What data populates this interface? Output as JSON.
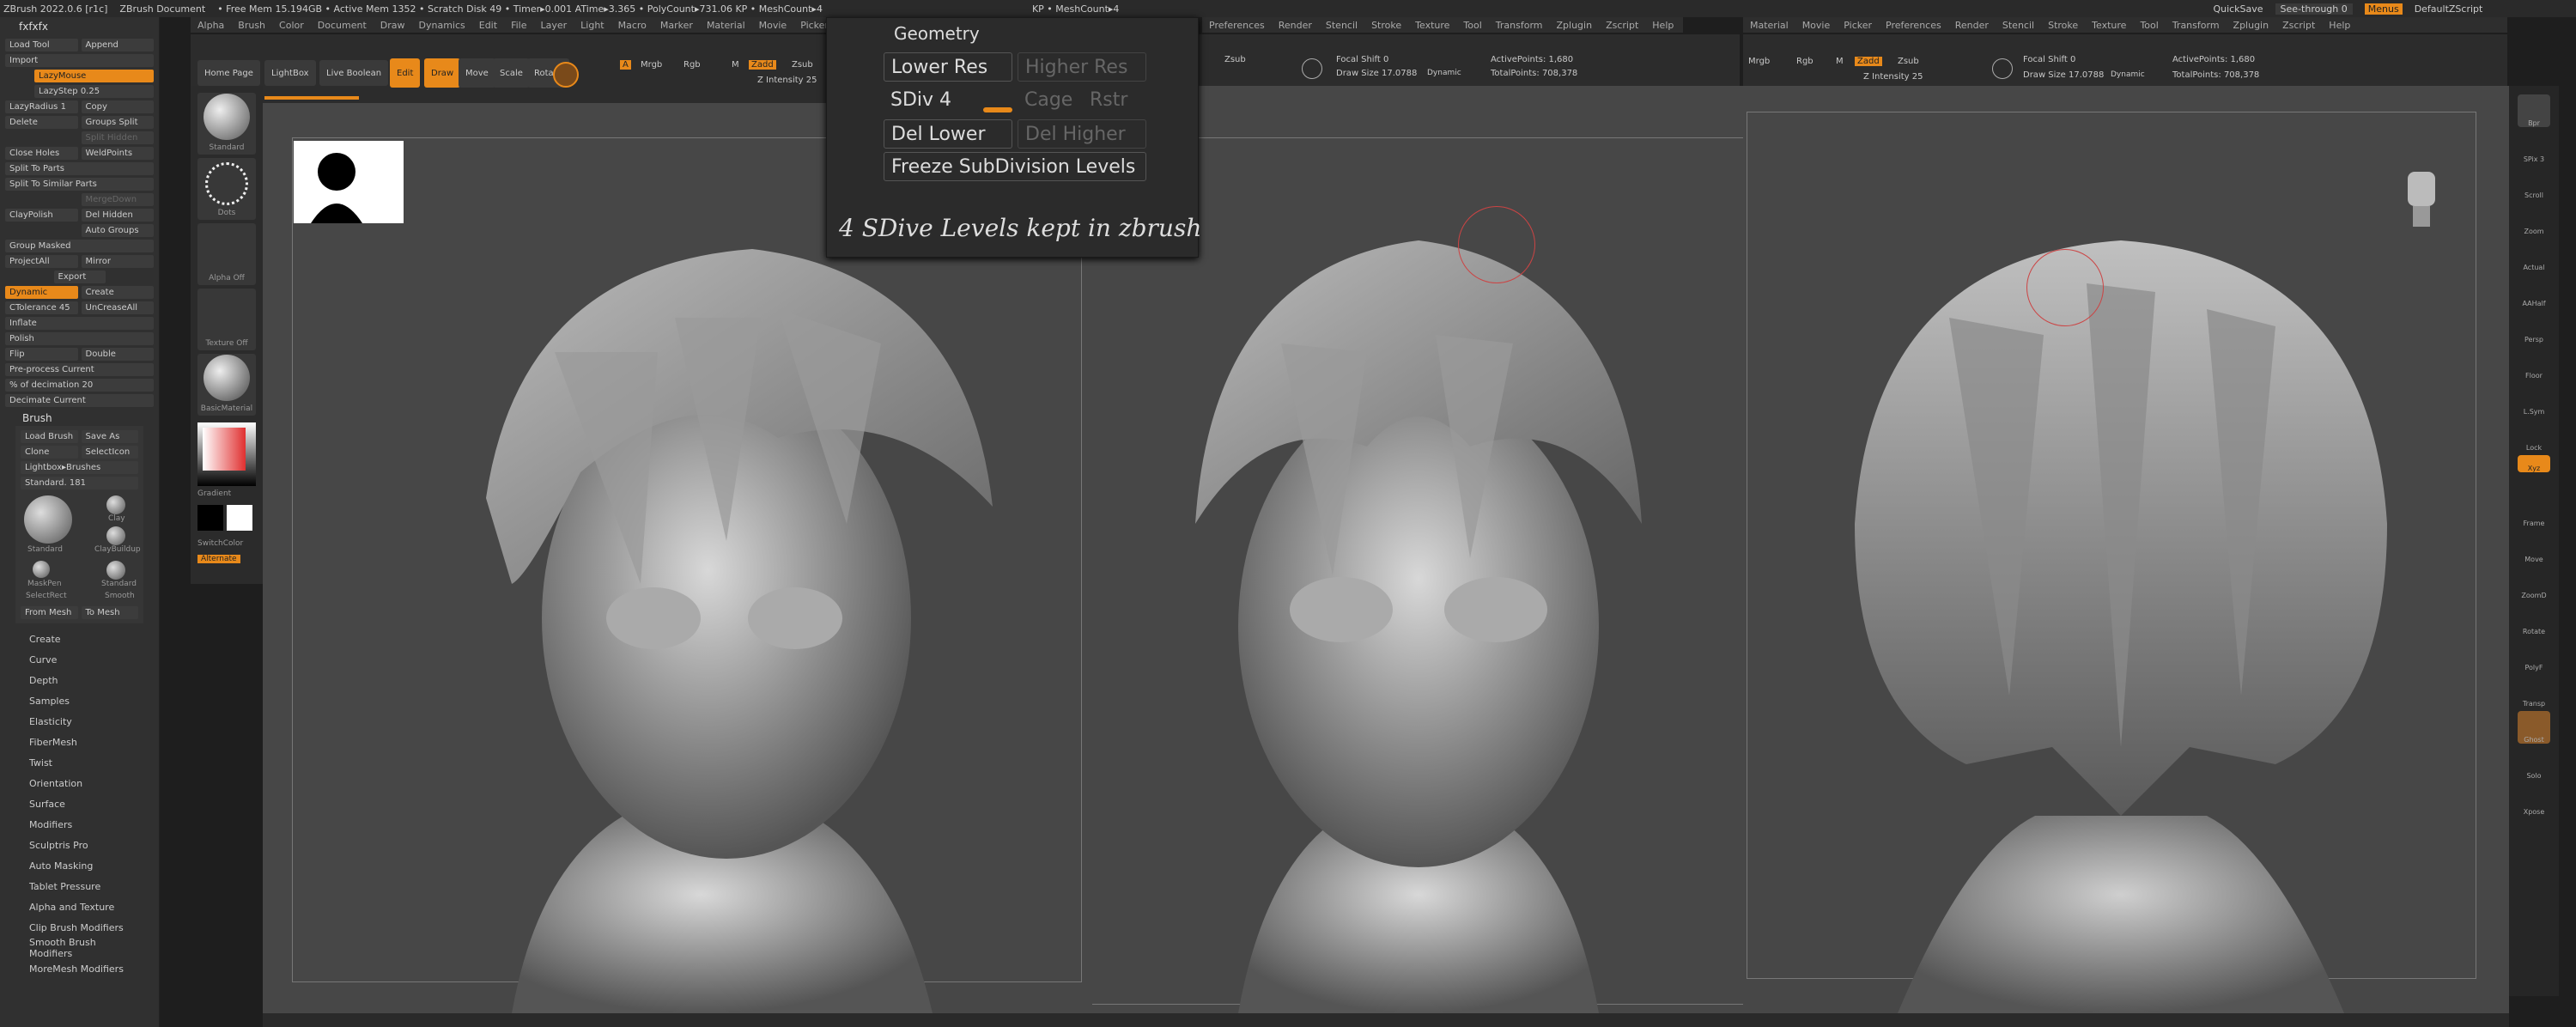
{
  "titlebar": {
    "app": "ZBrush 2022.0.6 [r1c]",
    "doc": "ZBrush Document",
    "stats": "• Free Mem 15.194GB • Active Mem 1352 • Scratch Disk 49 • Timer▸0.001 ATime▸3.365 • PolyCount▸731.06 KP • MeshCount▸4",
    "center": "KP • MeshCount▸4",
    "quicksave": "QuickSave",
    "seethrough": "See-through 0",
    "menus": "Menus",
    "script": "DefaultZScript"
  },
  "menus": [
    "Alpha",
    "Brush",
    "Color",
    "Document",
    "Draw",
    "Dynamics",
    "Edit",
    "File",
    "Layer",
    "Light",
    "Macro",
    "Marker",
    "Material",
    "Movie",
    "Picker",
    "Preferences",
    "Render",
    "Stencil",
    "Stroke",
    "Texture",
    "Tool",
    "Transform",
    "Zplugin",
    "Zscript",
    "Help"
  ],
  "left_panel": {
    "user": "fxfxfx",
    "buttons_top": [
      [
        "Load Tool",
        "Append"
      ],
      [
        "Import",
        ""
      ]
    ],
    "lazymouse": "LazyMouse",
    "lazystep": "LazyStep 0.25",
    "lazyradius": "LazyRadius 1",
    "copy": "Copy",
    "delete": "Delete",
    "groups_split": "Groups Split",
    "split_hidden": "Split Hidden",
    "close_holes": "Close Holes",
    "weldpoints": "WeldPoints",
    "split_to_parts": "Split To Parts",
    "split_similar": "Split To Similar Parts",
    "merge_down": "MergeDown",
    "clay_polish": "ClayPolish",
    "del_hidden": "Del Hidden",
    "auto_groups": "Auto Groups",
    "group_masked": "Group Masked",
    "project_all": "ProjectAll",
    "mirror": "Mirror",
    "export": "Export",
    "dynamic": "Dynamic",
    "create": "Create",
    "ctolerance": "CTolerance 45",
    "uncrease": "UnCreaseAll",
    "inflate": "Inflate",
    "polish": "Polish",
    "flip": "Flip",
    "double": "Double",
    "preprocess": "Pre-process Current",
    "decimation": "% of decimation 20",
    "decimate": "Decimate Current",
    "brush_title": "Brush",
    "load_brush": "Load Brush",
    "save_as": "Save As",
    "clone": "Clone",
    "selection": "SelectIcon",
    "lightbox_brushes": "Lightbox▸Brushes",
    "standard_value": "Standard. 181",
    "brush_names": [
      "Standard",
      "Clay",
      "ClayBuildup",
      "MaskPen",
      "Standard",
      "SelectRect",
      "Smooth"
    ],
    "from_mesh": "From Mesh",
    "to_mesh": "To Mesh",
    "subpalettes": [
      "Create",
      "Curve",
      "Depth",
      "Samples",
      "Elasticity",
      "FiberMesh",
      "Twist",
      "Orientation",
      "Surface",
      "Modifiers",
      "Sculptris Pro",
      "Auto Masking",
      "Tablet Pressure",
      "Alpha and Texture",
      "Clip Brush Modifiers",
      "Smooth Brush Modifiers",
      "MoreMesh Modifiers"
    ]
  },
  "shelf": [
    "Standard",
    "Dots",
    "Alpha Off",
    "Texture Off",
    "BasicMaterial",
    "Gradient",
    "SwitchColor",
    "Alternate"
  ],
  "toolbar": {
    "home": "Home Page",
    "lightbox": "LightBox",
    "live_boolean": "Live Boolean",
    "edit": "Edit",
    "draw": "Draw",
    "move": "Move",
    "scale": "Scale",
    "rotate": "Rotate",
    "a": "A",
    "mrgb": "Mrgb",
    "rgb": "Rgb",
    "m": "M",
    "zadd": "Zadd",
    "zsub": "Zsub",
    "zintensity": "Z Intensity 25",
    "focal_shift": "Focal Shift 0",
    "draw_size": "Draw Size 17.0788",
    "dynamic": "Dynamic",
    "active_points": "ActivePoints: 1,680",
    "total_points": "TotalPoints: 708,378"
  },
  "geometry_popup": {
    "title": "Geometry",
    "lower_res": "Lower Res",
    "higher_res": "Higher Res",
    "sdiv": "SDiv 4",
    "cage": "Cage",
    "rstr": "Rstr",
    "del_lower": "Del Lower",
    "del_higher": "Del Higher",
    "freeze": "Freeze SubDivision Levels",
    "caption": "4 SDive Levels kept in zbrush"
  },
  "right_bar": [
    "Bpr",
    "SPix 3",
    "Scroll",
    "Zoom",
    "Actual",
    "AAHalf",
    "Persp",
    "Floor",
    "L.Sym",
    "Lock",
    "Xyz",
    "Frame",
    "Move",
    "ZoomD",
    "Rotate",
    "PolyF",
    "Transp",
    "Ghost",
    "Solo",
    "Xpose"
  ]
}
